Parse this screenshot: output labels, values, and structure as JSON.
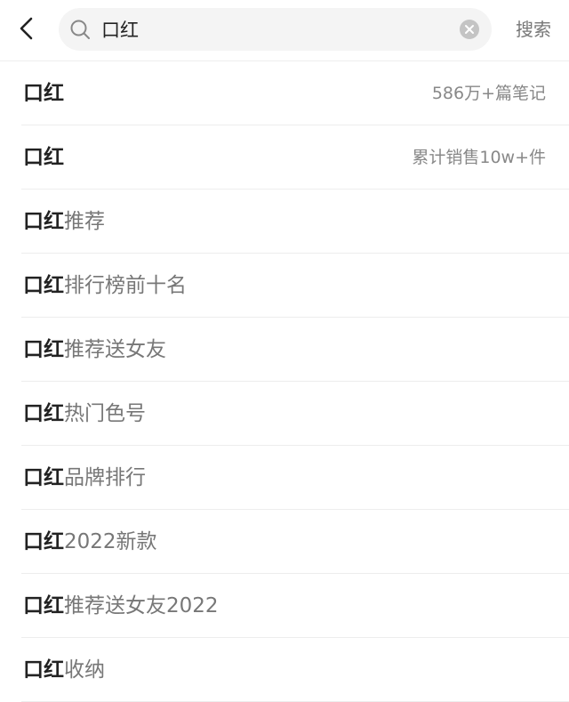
{
  "header": {
    "query": "口红",
    "search_label": "搜索"
  },
  "suggestions": [
    {
      "keyword": "口红",
      "rest": "",
      "meta": "586万+篇笔记"
    },
    {
      "keyword": "口红",
      "rest": "",
      "meta": "累计销售10w+件"
    },
    {
      "keyword": "口红",
      "rest": "推荐",
      "meta": ""
    },
    {
      "keyword": "口红",
      "rest": "排行榜前十名",
      "meta": ""
    },
    {
      "keyword": "口红",
      "rest": "推荐送女友",
      "meta": ""
    },
    {
      "keyword": "口红",
      "rest": "热门色号",
      "meta": ""
    },
    {
      "keyword": "口红",
      "rest": "品牌排行",
      "meta": ""
    },
    {
      "keyword": "口红",
      "rest": "2022新款",
      "meta": ""
    },
    {
      "keyword": "口红",
      "rest": "推荐送女友2022",
      "meta": ""
    },
    {
      "keyword": "口红",
      "rest": "收纳",
      "meta": ""
    }
  ]
}
